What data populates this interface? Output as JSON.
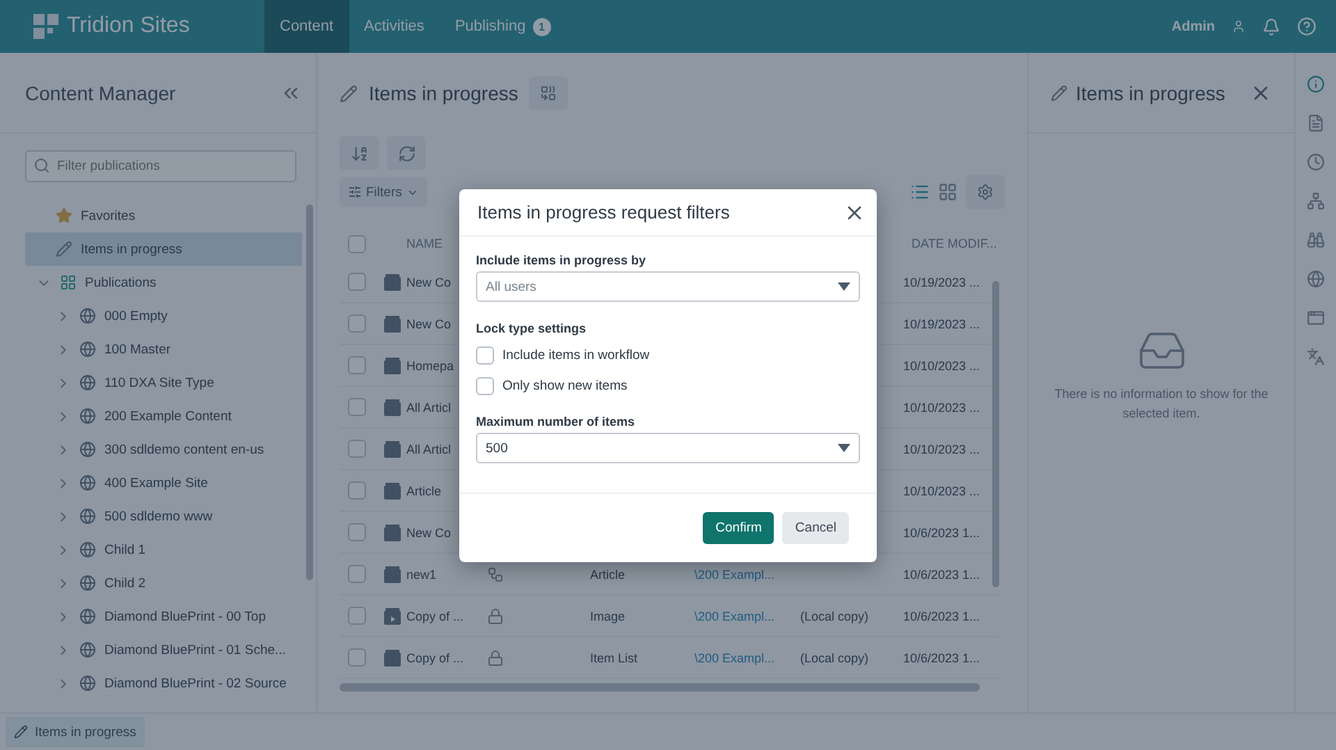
{
  "app": {
    "logo": "Tridion Sites",
    "nav": [
      {
        "label": "Content",
        "selected": true
      },
      {
        "label": "Activities",
        "selected": false
      },
      {
        "label": "Publishing",
        "selected": false,
        "badge": "1"
      }
    ],
    "user": "Admin"
  },
  "sidebar": {
    "title": "Content Manager",
    "filter": {
      "placeholder": "Filter publications"
    },
    "items": [
      {
        "label": "Favorites",
        "kind": "favorites",
        "selected": false
      },
      {
        "label": "Items in progress",
        "kind": "progress",
        "selected": true
      },
      {
        "label": "Publications",
        "kind": "publications",
        "selected": false,
        "expanded": true,
        "children": [
          {
            "label": "000 Empty",
            "expanded": false
          },
          {
            "label": "100 Master",
            "expanded": false
          },
          {
            "label": "110 DXA Site Type",
            "expanded": false
          },
          {
            "label": "200 Example Content",
            "expanded": false
          },
          {
            "label": "300 sdldemo content en-us",
            "expanded": false
          },
          {
            "label": "400 Example Site",
            "expanded": false
          },
          {
            "label": "500 sdldemo www",
            "expanded": false
          },
          {
            "label": "Child 1",
            "expanded": false
          },
          {
            "label": "Child 2",
            "expanded": false
          },
          {
            "label": "Diamond BluePrint - 00 Top",
            "expanded": false
          },
          {
            "label": "Diamond BluePrint - 01 Sche...",
            "expanded": false
          },
          {
            "label": "Diamond BluePrint - 02 Source",
            "expanded": false
          }
        ]
      }
    ]
  },
  "main": {
    "title": "Items in progress",
    "filters_button": "Filters",
    "table": {
      "columns": [
        "NAME",
        "DATE MODIF..."
      ],
      "all_checked": false,
      "rows": [
        {
          "checked": false,
          "name": "New Co",
          "date": "10/19/2023 ...",
          "kind": "component"
        },
        {
          "checked": false,
          "name": "New Co",
          "date": "10/19/2023 ...",
          "kind": "component"
        },
        {
          "checked": false,
          "name": "Homepa",
          "date": "10/10/2023 ...",
          "kind": "component"
        },
        {
          "checked": false,
          "name": "All Articl",
          "date": "10/10/2023 ...",
          "kind": "component"
        },
        {
          "checked": false,
          "name": "All Articl",
          "date": "10/10/2023 ...",
          "kind": "component"
        },
        {
          "checked": false,
          "name": "Article",
          "date": "10/10/2023 ...",
          "kind": "component"
        },
        {
          "checked": false,
          "name": "New Co",
          "date": "10/6/2023 1...",
          "kind": "component"
        },
        {
          "checked": false,
          "name": "new1",
          "in_workflow": true,
          "locked": false,
          "type": "Article",
          "path": "\\200 Exampl...",
          "date": "10/6/2023 1...",
          "kind": "component"
        },
        {
          "checked": false,
          "name": "Copy of ...",
          "in_workflow": false,
          "locked": true,
          "type": "Image",
          "path": "\\200 Exampl...",
          "column_5": "(Local copy)",
          "date": "10/6/2023 1...",
          "kind": "multimedia"
        },
        {
          "checked": false,
          "name": "Copy of ...",
          "in_workflow": false,
          "locked": true,
          "type": "Item List",
          "path": "\\200 Exampl...",
          "column_5": "(Local copy)",
          "date": "10/6/2023 1...",
          "kind": "component"
        }
      ]
    }
  },
  "details": {
    "title": "Items in progress",
    "empty_message": "There is no information to show for the selected item.",
    "rail": [
      {
        "kind": "info",
        "selected": true
      },
      {
        "kind": "document",
        "selected": false
      },
      {
        "kind": "history",
        "selected": false
      },
      {
        "kind": "hierarchy",
        "selected": false
      },
      {
        "kind": "binoculars",
        "selected": false
      },
      {
        "kind": "globe",
        "selected": false
      },
      {
        "kind": "window",
        "selected": false
      },
      {
        "kind": "translate",
        "selected": false
      }
    ]
  },
  "status_bar": {
    "tab": "Items in progress"
  },
  "dialog": {
    "title": "Items in progress request filters",
    "include_by": {
      "label": "Include items in progress by",
      "value": "All users"
    },
    "lock_settings": {
      "label": "Lock type settings",
      "options": [
        {
          "label": "Include items in workflow",
          "checked": false
        },
        {
          "label": "Only show new items",
          "checked": false
        }
      ]
    },
    "max_items": {
      "label": "Maximum number of items",
      "value": "500"
    },
    "buttons": [
      {
        "label": "Confirm",
        "kind": "primary"
      },
      {
        "label": "Cancel",
        "kind": "secondary"
      }
    ]
  }
}
